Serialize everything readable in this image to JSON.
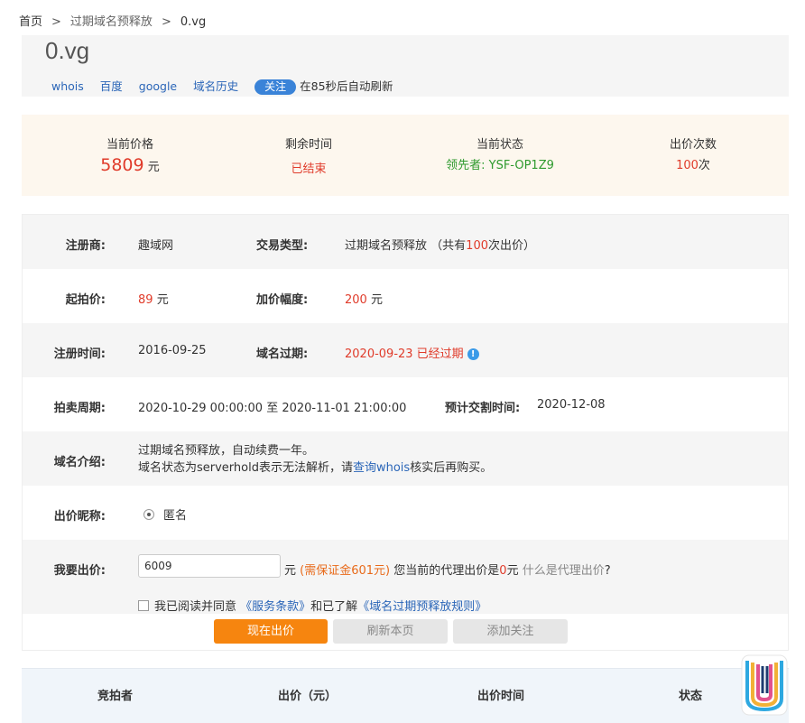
{
  "breadcrumb": {
    "home": "首页",
    "sep": ">",
    "category": "过期域名预释放",
    "current": "0.vg"
  },
  "header": {
    "domain": "0.vg",
    "links": [
      "whois",
      "百度",
      "google",
      "域名历史"
    ],
    "follow_label": "关注",
    "refresh_note": "在85秒后自动刷新"
  },
  "summary": {
    "price_label": "当前价格",
    "price_value": "5809",
    "price_unit": "元",
    "time_label": "剩余时间",
    "time_value": "已结束",
    "status_label": "当前状态",
    "status_value": "领先者: YSF-OP1Z9",
    "bids_label": "出价次数",
    "bids_value": "100",
    "bids_unit": "次"
  },
  "details": {
    "registrar_label": "注册商:",
    "registrar_value": "趣域网",
    "trade_type_label": "交易类型:",
    "trade_type_value": "过期域名预释放",
    "trade_type_note_pre": "（共有",
    "trade_type_count": "100",
    "trade_type_note_post": "次出价）",
    "start_price_label": "起拍价:",
    "start_price_value": "89",
    "start_price_unit": "元",
    "increment_label": "加价幅度:",
    "increment_value": "200",
    "increment_unit": "元",
    "reg_time_label": "注册时间:",
    "reg_time_value": "2016-09-25",
    "expire_label": "域名过期:",
    "expire_value": "2020-09-23 已经过期",
    "period_label": "拍卖周期:",
    "period_value": "2020-10-29 00:00:00 至 2020-11-01 21:00:00",
    "delivery_label": "预计交割时间:",
    "delivery_value": "2020-12-08",
    "intro_label": "域名介绍:",
    "intro_line1": "过期域名预释放，自动续费一年。",
    "intro_line2_pre": "域名状态为serverhold表示无法解析，请",
    "intro_line2_link": "查询whois",
    "intro_line2_post": "核实后再购买。",
    "nickname_label": "出价昵称:",
    "nickname_option": "匿名",
    "bid_label": "我要出价:",
    "bid_value": "6009",
    "bid_unit": "元",
    "deposit_note": "(需保证金601元)",
    "agent_pre": "您当前的代理出价是",
    "agent_value": "0",
    "agent_unit": "元",
    "agent_help": "什么是代理出价",
    "agent_q": "?",
    "agree_pre": "我已阅读并同意",
    "agree_terms": "《服务条款》",
    "agree_mid": "和已了解",
    "agree_rules": "《域名过期预释放规则》"
  },
  "buttons": {
    "bid_now": "现在出价",
    "refresh": "刷新本页",
    "add_follow": "添加关注"
  },
  "bid_table": {
    "headers": [
      "竞拍者",
      "出价（元）",
      "出价时间",
      "状态"
    ]
  },
  "colors": {
    "accent": "#f6850f",
    "price_red": "#e03b2a",
    "leader_green": "#2e9a2e",
    "link_blue": "#2b66b8"
  }
}
